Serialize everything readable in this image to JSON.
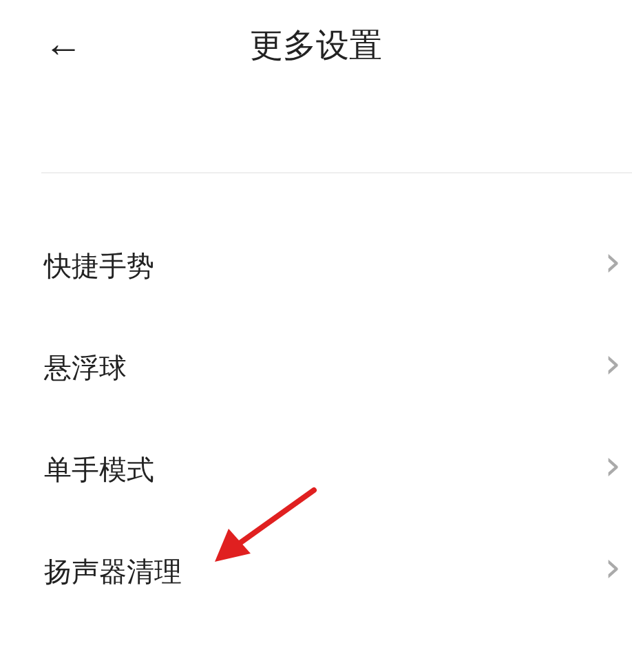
{
  "header": {
    "back": "←",
    "title": "更多设置"
  },
  "items": [
    {
      "label": "快捷手势",
      "chevron": "›"
    },
    {
      "label": "悬浮球",
      "chevron": "›"
    },
    {
      "label": "单手模式",
      "chevron": "›"
    },
    {
      "label": "扬声器清理",
      "chevron": "›"
    }
  ]
}
